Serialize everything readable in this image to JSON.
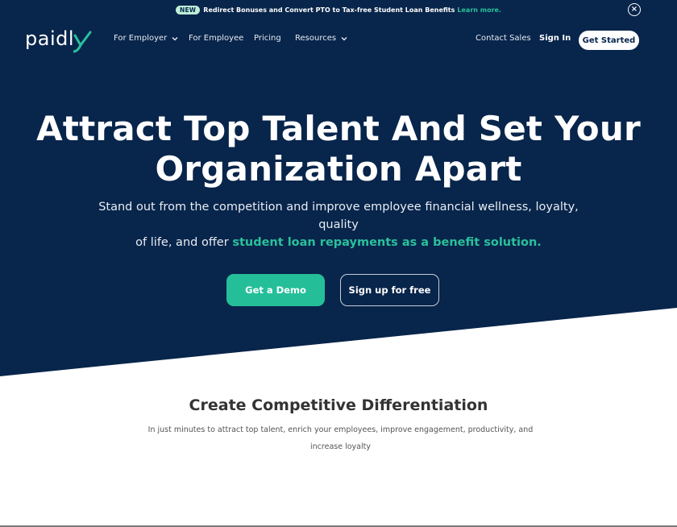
{
  "announcement": {
    "badge": "NEW",
    "text": "Redirect Bonuses and Convert PTO to Tax-free Student Loan Benefits",
    "link": "Learn more.",
    "close_icon": "×"
  },
  "nav": {
    "logo": "paidl",
    "items": [
      {
        "label": "For Employer",
        "has_dropdown": true
      },
      {
        "label": "For Employee",
        "has_dropdown": false
      },
      {
        "label": "Pricing",
        "has_dropdown": false
      },
      {
        "label": "Resources",
        "has_dropdown": true
      }
    ],
    "contact_sales": "Contact Sales",
    "sign_in": "Sign In",
    "get_started": "Get Started"
  },
  "hero": {
    "title_line1": "Attract Top Talent And Set Your",
    "title_line2": "Organization Apart",
    "subtitle_line1": "Stand out from the competition and improve employee financial wellness, loyalty, quality",
    "subtitle_line2_prefix": "of life, and offer ",
    "subtitle_accent": "student loan repayments as a benefit solution.",
    "cta_primary": "Get a Demo",
    "cta_secondary": "Sign up for free"
  },
  "section": {
    "title": "Create Competitive Differentiation",
    "text_line1": "In just minutes to attract top talent, enrich your employees, improve engagement, productivity, and",
    "text_line2": "increase loyalty"
  },
  "colors": {
    "navy": "#08254b",
    "accent": "#2ac09b",
    "button_green": "#24bf99"
  }
}
